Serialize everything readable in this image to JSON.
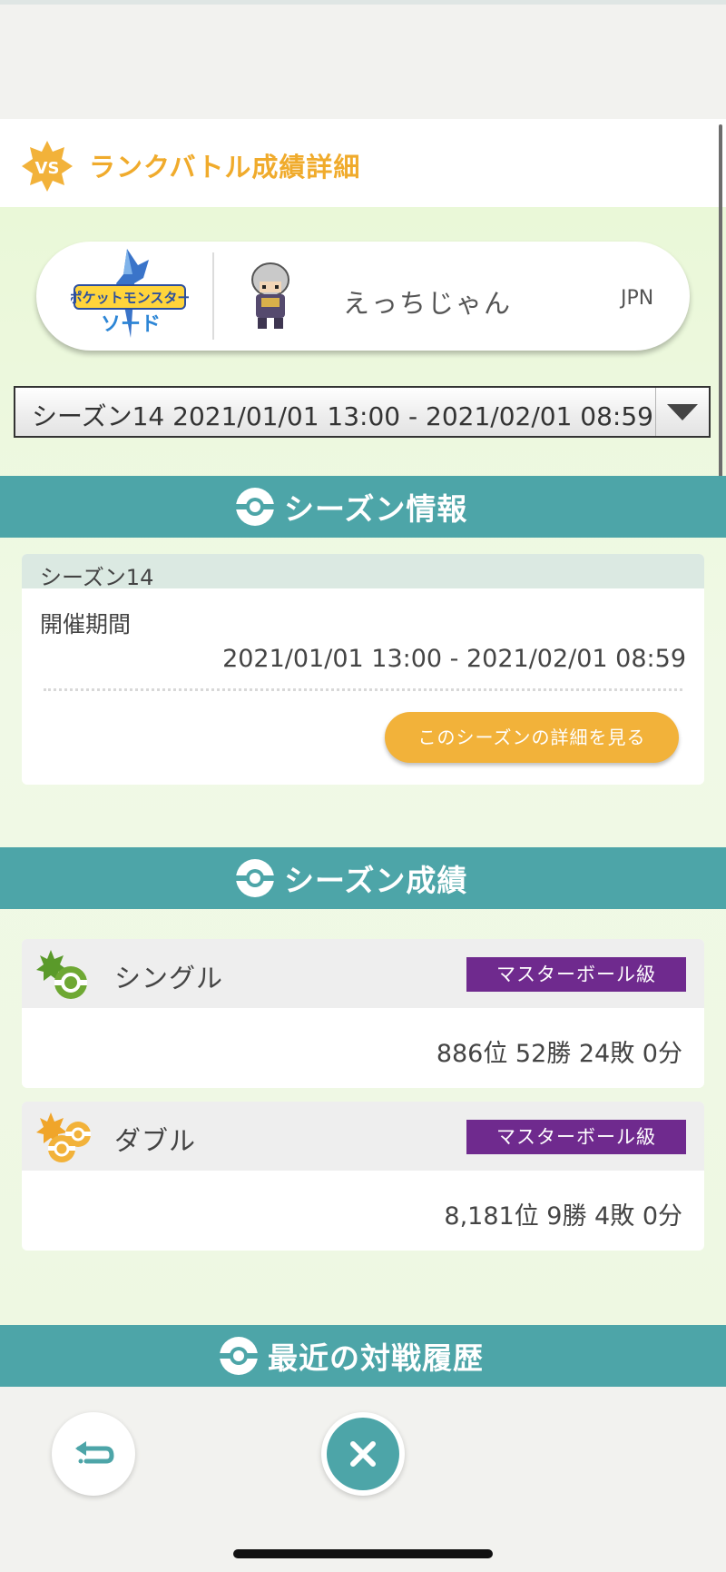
{
  "header": {
    "title": "ランクバトル成績詳細",
    "badge_text": "VS"
  },
  "profile": {
    "game_logo_alt": "ポケットモンスター ソード",
    "player_name": "えっちじゃん",
    "region": "JPN"
  },
  "season_select": {
    "selected": "シーズン14 2021/01/01 13:00 - 2021/02/01 08:59"
  },
  "season_info": {
    "section_title": "シーズン情報",
    "card_header": "シーズン14",
    "period_label": "開催期間",
    "period_value": "2021/01/01 13:00 - 2021/02/01 08:59",
    "detail_button": "このシーズンの詳細を見る"
  },
  "season_results": {
    "section_title": "シーズン成績",
    "items": [
      {
        "label": "シングル",
        "rank_class": "マスターボール級",
        "record": "886位 52勝 24敗 0分",
        "icon": "single-battle-icon"
      },
      {
        "label": "ダブル",
        "rank_class": "マスターボール級",
        "record": "8,181位 9勝 4敗 0分",
        "icon": "double-battle-icon"
      }
    ]
  },
  "recent_battles": {
    "section_title": "最近の対戦履歴"
  },
  "colors": {
    "accent_teal": "#4da5a8",
    "accent_orange": "#f2b23a",
    "rank_purple": "#6f2a8e",
    "title_orange": "#f0ab2c"
  }
}
